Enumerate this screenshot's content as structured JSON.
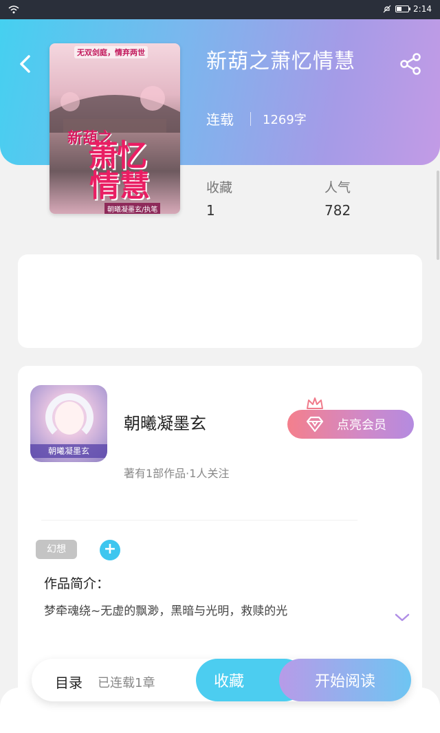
{
  "status_bar": {
    "time": "2:14"
  },
  "book": {
    "title": "新葫之萧忆情慧",
    "status": "连载",
    "word_count": "1269字",
    "cover": {
      "tagline": "无双剑庭，情弃两世",
      "title_line1": "新葫之",
      "title_line2": "萧忆",
      "title_line3": "情慧",
      "author_strip": "朝曦凝墨玄/执笔"
    }
  },
  "stats": {
    "collect_label": "收藏",
    "collect_value": "1",
    "popularity_label": "人气",
    "popularity_value": "782"
  },
  "author": {
    "name": "朝曦凝墨玄",
    "meta": "著有1部作品·1人关注",
    "avatar_banner": "朝曦凝墨玄",
    "vip_button_label": "点亮会员"
  },
  "tags": [
    "幻想"
  ],
  "intro": {
    "label": "作品简介：",
    "text": "梦牵魂绕~无虚的飘渺，黑暗与光明，救赎的光"
  },
  "action_bar": {
    "toc_label": "目录",
    "chapter_count": "已连载1章",
    "collect_button": "收藏",
    "read_button": "开始阅读"
  },
  "colors": {
    "header_start": "#45d0f0",
    "header_end": "#c39be6",
    "collect_button": "#4ccdf0",
    "tag_add": "#3ec6ef"
  },
  "icons": {
    "back": "chevron-left-icon",
    "share": "share-icon",
    "crown": "crown-icon",
    "diamond": "diamond-icon",
    "add": "plus-icon",
    "expand": "chevron-down-icon"
  }
}
